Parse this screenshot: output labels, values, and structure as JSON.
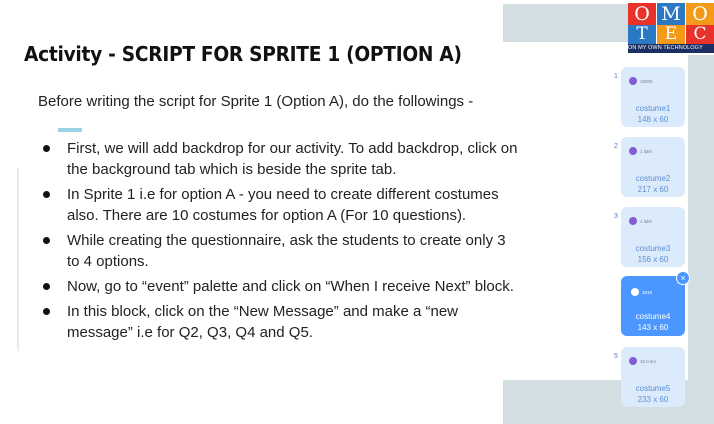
{
  "logo": {
    "letters_row1": [
      "O",
      "M",
      "O"
    ],
    "letters_row2": [
      "T",
      "E",
      "C"
    ],
    "tagline": "ON MY OWN TECHNOLOGY",
    "colors": {
      "red": "#e8322a",
      "blue": "#2b78c5",
      "orange": "#f39a1b",
      "navy": "#1c2f63"
    }
  },
  "title": "Activity  - SCRIPT FOR SPRITE 1 (OPTION A)",
  "intro": "Before writing the script for Sprite 1 (Option A), do the followings -",
  "bullets": [
    "First, we will add backdrop for our activity. To add backdrop, click on the background tab which is beside the sprite tab.",
    "In Sprite 1 i.e for option A - you need to create different costumes also. There are 10 costumes for option A (For 10 questions).",
    "While creating the questionnaire, ask the students to create only 3 to 4 options.",
    "Now, go to “event” palette and click on “When I receive Next” block.",
    "In this block, click on the “New Message” and make a “new message” i.e for Q2, Q3, Q4 and Q5."
  ],
  "costumes": [
    {
      "number": "1",
      "thumb_text": "10000",
      "name": "costume1",
      "size": "148 x 60",
      "selected": false
    },
    {
      "number": "2",
      "thumb_text": "1 lakh",
      "name": "costume2",
      "size": "217 x 60",
      "selected": false
    },
    {
      "number": "3",
      "thumb_text": "4 lakh",
      "name": "costume3",
      "size": "156 x 60",
      "selected": false
    },
    {
      "number": "4",
      "thumb_text": "2010",
      "name": "costume4",
      "size": "143 x 60",
      "selected": true
    },
    {
      "number": "5",
      "thumb_text": "10.0 km",
      "name": "costume5",
      "size": "233 x 60",
      "selected": false
    }
  ],
  "close_icon": "×"
}
